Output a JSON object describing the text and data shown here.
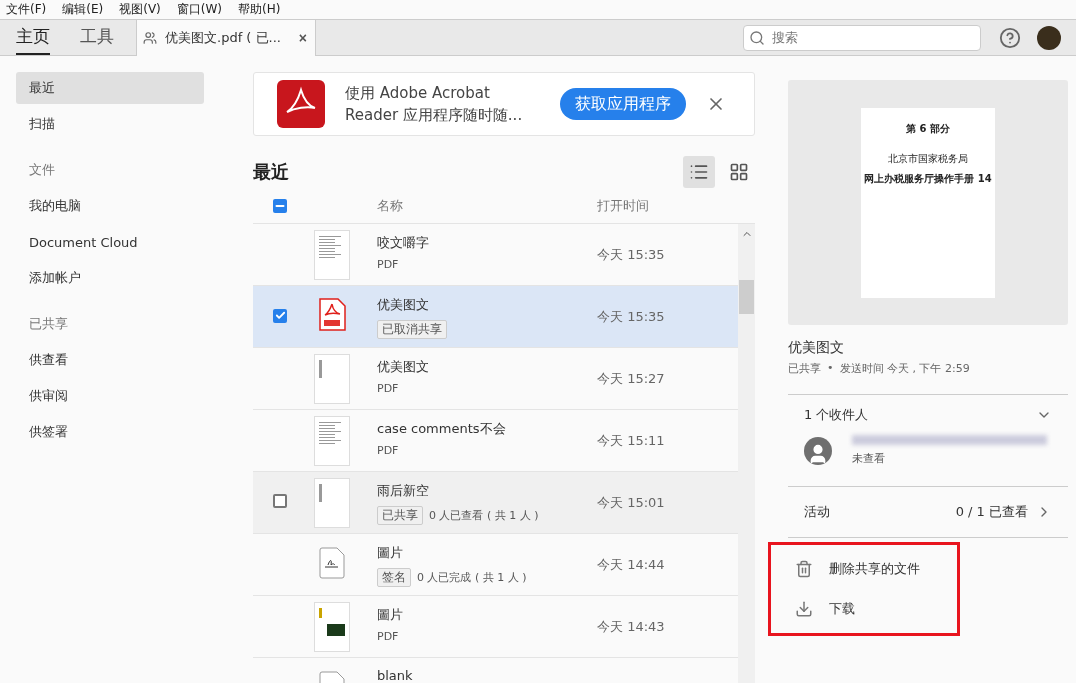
{
  "menu": [
    "文件(F)",
    "编辑(E)",
    "视图(V)",
    "窗口(W)",
    "帮助(H)"
  ],
  "tabs": [
    {
      "label": "主页",
      "selected": true
    },
    {
      "label": "工具",
      "selected": false
    }
  ],
  "doc_tab": {
    "title": "优美图文.pdf ( 已...",
    "close": "×"
  },
  "search": {
    "placeholder": "搜索"
  },
  "sidebar": [
    {
      "label": "最近",
      "kind": "item",
      "selected": true
    },
    {
      "label": "扫描",
      "kind": "item",
      "selected": false
    },
    {
      "label": "文件",
      "kind": "heading",
      "selected": false
    },
    {
      "label": "我的电脑",
      "kind": "item",
      "selected": false
    },
    {
      "label": "Document Cloud",
      "kind": "item",
      "selected": false
    },
    {
      "label": "添加帐户",
      "kind": "item",
      "selected": false
    },
    {
      "label": "已共享",
      "kind": "heading",
      "selected": false
    },
    {
      "label": "供查看",
      "kind": "item",
      "selected": false
    },
    {
      "label": "供审阅",
      "kind": "item",
      "selected": false
    },
    {
      "label": "供签署",
      "kind": "item",
      "selected": false
    }
  ],
  "banner": {
    "text": "使用 Adobe Acrobat Reader 应用程序随时随...",
    "button": "获取应用程序"
  },
  "section_title": "最近",
  "view_modes": [
    {
      "kind": "list",
      "selected": true
    },
    {
      "kind": "grid",
      "selected": false
    }
  ],
  "table": {
    "select_all": {
      "partial": true
    },
    "columns": [
      "名称",
      "打开时间"
    ],
    "rows": [
      {
        "kind": "doc",
        "name": "咬文嚼字",
        "subtitle": "PDF",
        "time": "今天 15:35",
        "selected": false,
        "hovered": false,
        "checked": false
      },
      {
        "kind": "pdf",
        "name": "优美图文",
        "tag": "已取消共享",
        "time": "今天 15:35",
        "selected": true,
        "hovered": false,
        "checked": true
      },
      {
        "kind": "sparse",
        "name": "优美图文",
        "subtitle": "PDF",
        "time": "今天 15:27",
        "selected": false,
        "hovered": false,
        "checked": false
      },
      {
        "kind": "doc",
        "name": "case comments不会",
        "subtitle": "PDF",
        "time": "今天 15:11",
        "selected": false,
        "hovered": false,
        "checked": false
      },
      {
        "kind": "sparse",
        "name": "雨后新空",
        "tag": "已共享",
        "note": "0 人已查看 ( 共 1 人 )",
        "time": "今天 15:01",
        "selected": false,
        "hovered": true,
        "checked": false
      },
      {
        "kind": "sign",
        "name": "圖片",
        "tag": "签名",
        "note": "0 人已完成 ( 共 1 人 )",
        "time": "今天 14:44",
        "selected": false,
        "hovered": false,
        "checked": false
      },
      {
        "kind": "image",
        "name": "圖片",
        "subtitle": "PDF",
        "time": "今天 14:43",
        "selected": false,
        "hovered": false,
        "checked": false
      },
      {
        "kind": "sign",
        "name": "blank",
        "selected": false,
        "hovered": false,
        "checked": false
      }
    ]
  },
  "details": {
    "preview": {
      "lines": [
        "第 6 部分",
        "北京市国家税务局",
        "网上办税服务厅操作手册 14"
      ]
    },
    "file_name": "优美图文",
    "status": "已共享",
    "separator": "•",
    "sent": "发送时间 今天 , 下午 2:59",
    "recipients": {
      "title": "1 个收件人",
      "expanded": true,
      "items": [
        {
          "status": "未查看"
        }
      ]
    },
    "activity": {
      "label": "活动",
      "value": "0 / 1 已查看"
    },
    "actions": [
      {
        "kind": "delete",
        "label": "删除共享的文件"
      },
      {
        "kind": "download",
        "label": "下载"
      }
    ],
    "highlighted": true
  }
}
